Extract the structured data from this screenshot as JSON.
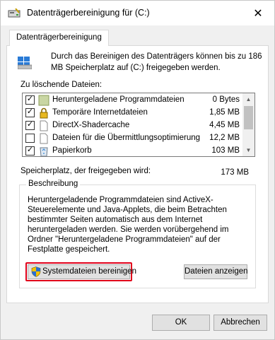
{
  "window": {
    "title": "Datenträgerbereinigung für  (C:)",
    "close_glyph": "✕"
  },
  "tabs": [
    {
      "label": "Datenträgerbereinigung"
    }
  ],
  "intro_text": "Durch das Bereinigen des Datenträgers können bis zu 186 MB Speicherplatz auf  (C:) freigegeben werden.",
  "files_label": "Zu löschende Dateien:",
  "files": [
    {
      "name": "Heruntergeladene Programmdateien",
      "size": "0 Bytes",
      "checked": true,
      "icon": "folder-icon"
    },
    {
      "name": "Temporäre Internetdateien",
      "size": "1,85 MB",
      "checked": true,
      "icon": "lock-icon"
    },
    {
      "name": "DirectX-Shadercache",
      "size": "4,45 MB",
      "checked": true,
      "icon": "file-icon"
    },
    {
      "name": "Dateien für die Übermittlungsoptimierung",
      "size": "12,2 MB",
      "checked": false,
      "icon": "file-icon"
    },
    {
      "name": "Papierkorb",
      "size": "103 MB",
      "checked": true,
      "icon": "recycle-bin-icon"
    }
  ],
  "space_label": "Speicherplatz, der freigegeben wird:",
  "space_value": "173 MB",
  "description": {
    "label": "Beschreibung",
    "text": "Heruntergeladende Programmdateien sind ActiveX-Steuerelemente und Java-Applets, die beim Betrachten bestimmter Seiten automatisch aus dem Internet heruntergeladen werden. Sie werden vorübergehend im Ordner \"Heruntergeladene Programmdateien\" auf der Festplatte gespeichert."
  },
  "buttons": {
    "cleanup_system": "Systemdateien bereinigen",
    "view_files": "Dateien anzeigen",
    "ok": "OK",
    "cancel": "Abbrechen"
  },
  "colors": {
    "highlight": "#e0001a",
    "panel": "#ffffff",
    "window": "#f0f0f0"
  }
}
